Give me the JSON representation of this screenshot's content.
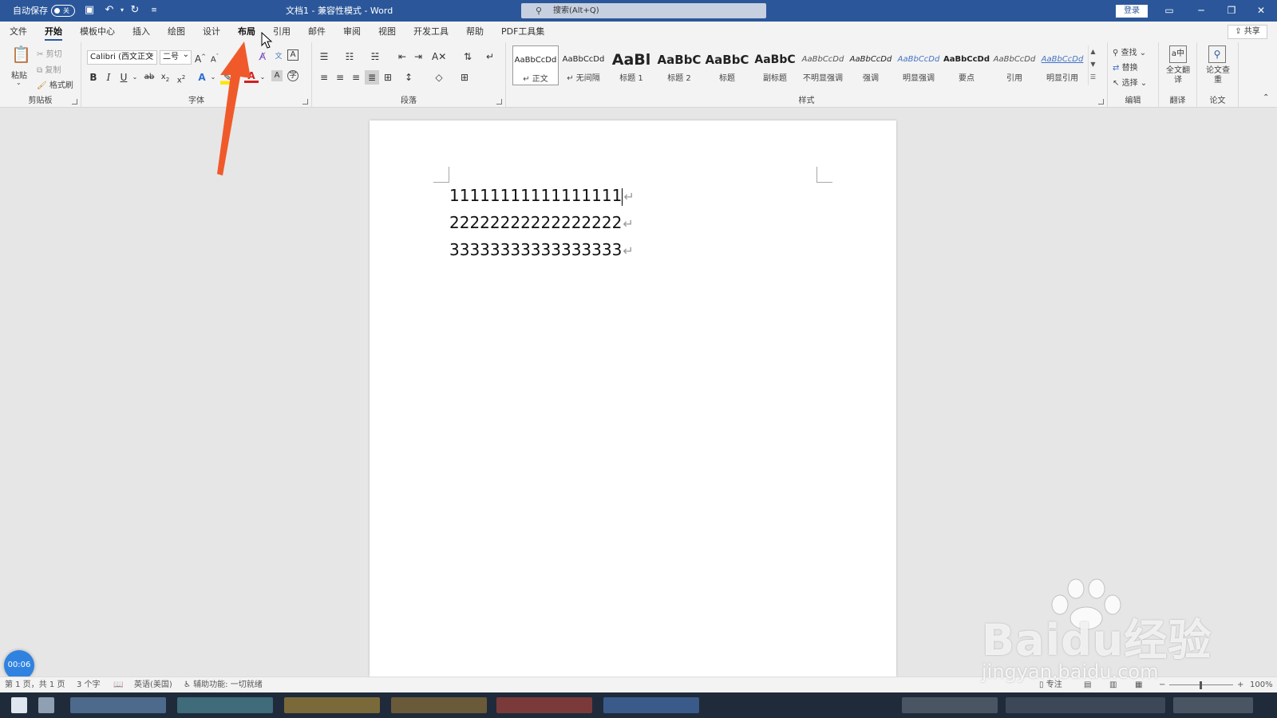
{
  "titlebar": {
    "autosave_label": "自动保存",
    "autosave_state": "关",
    "doc_title": "文档1 - 兼容性模式 - Word",
    "search_placeholder": "搜索(Alt+Q)",
    "login_label": "登录",
    "bg_color": "#2b579a"
  },
  "tabs": [
    {
      "label": "文件",
      "active": false
    },
    {
      "label": "开始",
      "active": true
    },
    {
      "label": "模板中心",
      "active": false
    },
    {
      "label": "插入",
      "active": false
    },
    {
      "label": "绘图",
      "active": false
    },
    {
      "label": "设计",
      "active": false
    },
    {
      "label": "布局",
      "active": false
    },
    {
      "label": "引用",
      "active": false
    },
    {
      "label": "邮件",
      "active": false
    },
    {
      "label": "审阅",
      "active": false
    },
    {
      "label": "视图",
      "active": false
    },
    {
      "label": "开发工具",
      "active": false
    },
    {
      "label": "帮助",
      "active": false
    },
    {
      "label": "PDF工具集",
      "active": false
    }
  ],
  "share_label": "共享",
  "ribbon": {
    "clipboard": {
      "label": "剪贴板",
      "paste": "粘贴",
      "cut": "剪切",
      "copy": "复制",
      "format_painter": "格式刷"
    },
    "font": {
      "label": "字体",
      "font_name": "Calibri (西文正文",
      "font_size": "二号"
    },
    "paragraph": {
      "label": "段落"
    },
    "styles": {
      "label": "样式",
      "items": [
        {
          "preview": "AaBbCcDd",
          "name": "↵ 正文"
        },
        {
          "preview": "AaBbCcDd",
          "name": "↵ 无间隔"
        },
        {
          "preview": "AaBl",
          "name": "标题 1"
        },
        {
          "preview": "AaBbC",
          "name": "标题 2"
        },
        {
          "preview": "AaBbC",
          "name": "标题"
        },
        {
          "preview": "AaBbC",
          "name": "副标题"
        },
        {
          "preview": "AaBbCcDd",
          "name": "不明显强调"
        },
        {
          "preview": "AaBbCcDd",
          "name": "强调"
        },
        {
          "preview": "AaBbCcDd",
          "name": "明显强调"
        },
        {
          "preview": "AaBbCcDd",
          "name": "要点"
        },
        {
          "preview": "AaBbCcDd",
          "name": "引用"
        },
        {
          "preview": "AaBbCcDd",
          "name": "明显引用"
        }
      ]
    },
    "editing": {
      "label": "编辑",
      "find": "查找",
      "replace": "替换",
      "select": "选择"
    },
    "translate": {
      "label": "翻译",
      "button": "全文翻译"
    },
    "paper": {
      "label": "论文",
      "button": "论文查重"
    }
  },
  "document": {
    "lines": [
      "11111111111111111",
      "22222222222222222",
      "33333333333333333"
    ]
  },
  "timer": "00:06",
  "status": {
    "page": "第 1 页，共 1 页",
    "words": "3 个字",
    "language": "英语(美国)",
    "accessibility": "辅助功能: 一切就绪",
    "focus": "专注",
    "zoom": "100%"
  },
  "watermark": {
    "brand": "Baidu经验",
    "url": "jingyan.baidu.com"
  },
  "accent_color": "#f05a2a"
}
